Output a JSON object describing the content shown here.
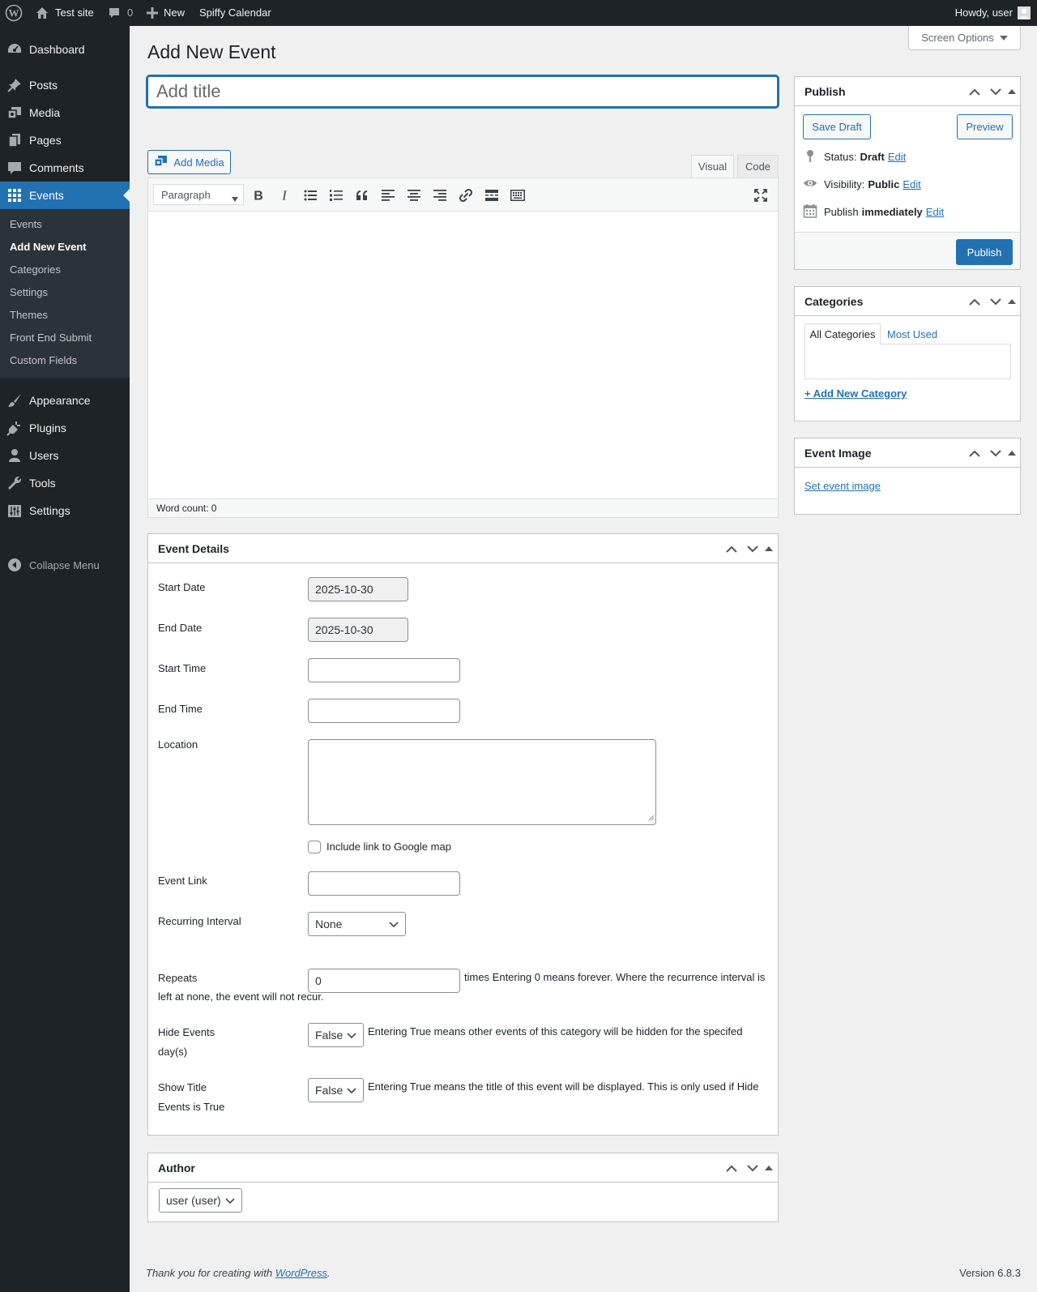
{
  "admin_bar": {
    "site_name": "Test site",
    "comments_count": "0",
    "new_label": "New",
    "plugin_label": "Spiffy Calendar",
    "howdy": "Howdy, user"
  },
  "sidebar": {
    "items": [
      {
        "label": "Dashboard",
        "icon": "dashboard-icon"
      },
      {
        "label": "Posts",
        "icon": "pin-icon"
      },
      {
        "label": "Media",
        "icon": "media-icon"
      },
      {
        "label": "Pages",
        "icon": "pages-icon"
      },
      {
        "label": "Comments",
        "icon": "comments-icon"
      },
      {
        "label": "Events",
        "icon": "grid-icon"
      },
      {
        "label": "Appearance",
        "icon": "brush-icon"
      },
      {
        "label": "Plugins",
        "icon": "plugin-icon"
      },
      {
        "label": "Users",
        "icon": "users-icon"
      },
      {
        "label": "Tools",
        "icon": "wrench-icon"
      },
      {
        "label": "Settings",
        "icon": "settings-icon"
      }
    ],
    "submenu": [
      "Events",
      "Add New Event",
      "Categories",
      "Settings",
      "Themes",
      "Front End Submit",
      "Custom Fields"
    ],
    "collapse_label": "Collapse Menu"
  },
  "screen_options": "Screen Options",
  "page_title": "Add New Event",
  "title_placeholder": "Add title",
  "editor": {
    "add_media": "Add Media",
    "tab_visual": "Visual",
    "tab_code": "Code",
    "format": "Paragraph",
    "word_count": "Word count: 0"
  },
  "event_details": {
    "title": "Event Details",
    "start_date_label": "Start Date",
    "start_date": "2025-10-30",
    "end_date_label": "End Date",
    "end_date": "2025-10-30",
    "start_time_label": "Start Time",
    "end_time_label": "End Time",
    "location_label": "Location",
    "google_map_label": "Include link to Google map",
    "event_link_label": "Event Link",
    "recurring_label": "Recurring Interval",
    "recurring_value": "None",
    "repeats_label": "Repeats",
    "repeats_value": "0",
    "repeats_desc_1": "times Entering 0 means forever. Where the recurrence interval is",
    "repeats_desc_2": "left at none, the event will not recur.",
    "hide_events_label_1": "Hide Events",
    "hide_events_label_2": "day(s)",
    "hide_events_value": "False",
    "hide_events_desc": "Entering True means other events of this category will be hidden for the specifed",
    "show_title_label_1": "Show Title",
    "show_title_label_2": "Events is True",
    "show_title_value": "False",
    "show_title_desc": "Entering True means the title of this event will be displayed. This is only used if Hide"
  },
  "author": {
    "title": "Author",
    "value": "user (user)"
  },
  "publish": {
    "title": "Publish",
    "save_draft": "Save Draft",
    "preview": "Preview",
    "status_label": "Status:",
    "status_value": "Draft",
    "visibility_label": "Visibility:",
    "visibility_value": "Public",
    "publish_label": "Publish",
    "publish_value": "immediately",
    "edit": "Edit",
    "publish_button": "Publish"
  },
  "categories": {
    "title": "Categories",
    "tab_all": "All Categories",
    "tab_most_used": "Most Used",
    "add_new": "+ Add New Category"
  },
  "event_image": {
    "title": "Event Image",
    "set_image": "Set event image"
  },
  "footer": {
    "thanks_prefix": "Thank you for creating with ",
    "wordpress": "WordPress",
    "thanks_suffix": ".",
    "version": "Version 6.8.3"
  },
  "colors": {
    "admin_bg": "#1d2327",
    "accent": "#2271b1",
    "page_bg": "#f0f0f1"
  }
}
